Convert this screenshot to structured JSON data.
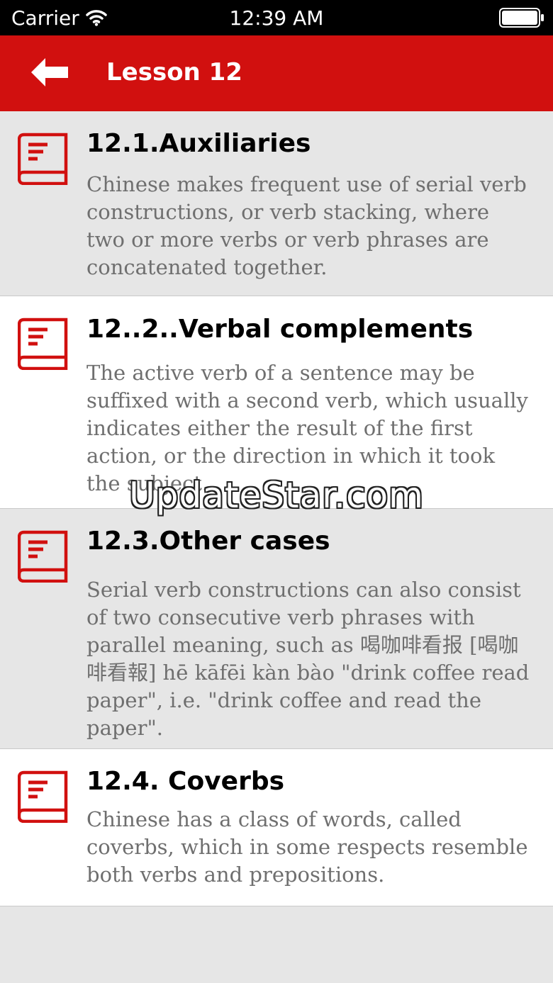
{
  "status_bar": {
    "carrier": "Carrier",
    "time": "12:39 AM",
    "wifi_icon": "wifi-icon",
    "battery_icon": "battery-icon"
  },
  "nav": {
    "back_icon": "back-arrow-icon",
    "title": "Lesson 12"
  },
  "colors": {
    "accent": "#d1100f",
    "row_gray": "#e6e6e6",
    "row_white": "#ffffff",
    "description_text": "#6f6f6f"
  },
  "items": [
    {
      "icon": "book-icon",
      "title": "12.1.Auxiliaries",
      "description": "Chinese makes frequent use of serial verb constructions, or verb stacking, where two or more verbs or verb phrases are concatenated together."
    },
    {
      "icon": "book-icon",
      "title": "12..2..Verbal complements",
      "description": "The active verb of a sentence may be suffixed with a second verb, which usually indicates either the result of the first action, or the direction in which it took the subject."
    },
    {
      "icon": "book-icon",
      "title": "12.3.Other cases",
      "description": "Serial verb constructions can also consist of two consecutive verb phrases with parallel meaning, such as 喝咖啡看报 [喝咖啡看報] hē kāfēi kàn bào \"drink coffee read paper\", i.e. \"drink coffee and read the paper\"."
    },
    {
      "icon": "book-icon",
      "title": "12.4. Coverbs",
      "description": "Chinese has a class of words, called coverbs, which in some respects resemble both verbs and prepositions."
    }
  ],
  "watermark": "UpdateStar.com"
}
